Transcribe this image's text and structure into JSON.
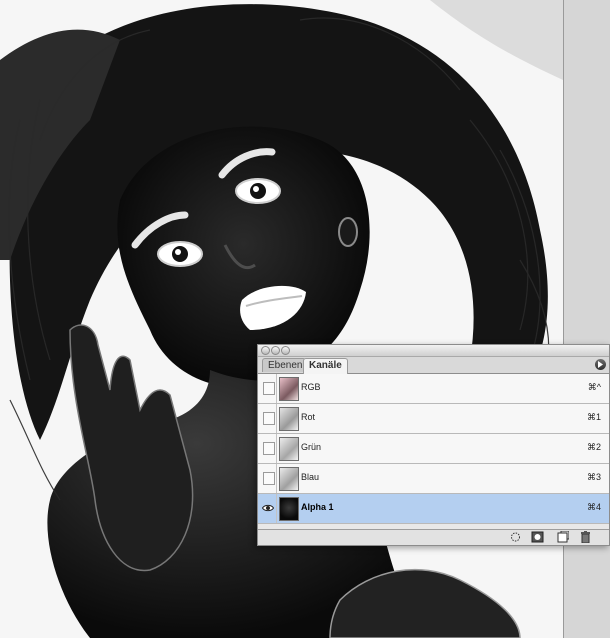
{
  "panel": {
    "tabs": [
      {
        "label": "Ebenen",
        "active": false
      },
      {
        "label": "Kanäle",
        "active": true
      }
    ],
    "channels": [
      {
        "name": "RGB",
        "shortcut": "⌘^",
        "visible": false,
        "selected": false
      },
      {
        "name": "Rot",
        "shortcut": "⌘1",
        "visible": false,
        "selected": false
      },
      {
        "name": "Grün",
        "shortcut": "⌘2",
        "visible": false,
        "selected": false
      },
      {
        "name": "Blau",
        "shortcut": "⌘3",
        "visible": false,
        "selected": false
      },
      {
        "name": "Alpha 1",
        "shortcut": "⌘4",
        "visible": true,
        "selected": true
      }
    ],
    "footer_icons": [
      "load-selection-icon",
      "save-selection-icon",
      "new-channel-icon",
      "delete-channel-icon"
    ]
  },
  "colors": {
    "selected_row": "#b4cff0",
    "panel_bg": "#e8e8e8"
  }
}
